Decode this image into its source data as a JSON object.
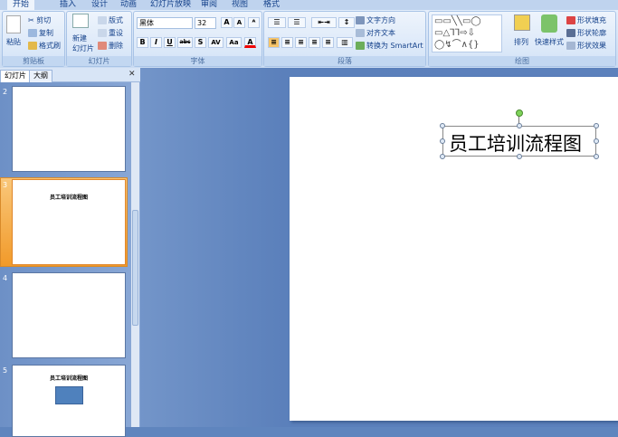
{
  "ribbon": {
    "tabs": [
      "开始",
      "插入",
      "设计",
      "动画",
      "幻灯片放映",
      "审阅",
      "视图",
      "格式"
    ],
    "clipboard": {
      "paste": "粘贴",
      "cut": "剪切",
      "copy": "复制",
      "format_painter": "格式刷",
      "label": "剪贴板"
    },
    "slides": {
      "new_slide": "新建",
      "new_slide2": "幻灯片",
      "layout": "版式",
      "reset": "重设",
      "delete": "删除",
      "label": "幻灯片"
    },
    "font": {
      "font_name": "黑体",
      "font_size": "32",
      "bold": "B",
      "italic": "I",
      "underline": "U",
      "strike": "abc",
      "shadow": "S",
      "spacing": "AV",
      "case": "Aa",
      "color": "A",
      "grow": "A",
      "shrink": "A",
      "label": "字体"
    },
    "paragraph": {
      "text_direction": "文字方向",
      "align_text": "对齐文本",
      "smartart": "转换为 SmartArt",
      "label": "段落"
    },
    "drawing": {
      "arrange": "排列",
      "quick_styles": "快速样式",
      "fill": "形状填充",
      "outline": "形状轮廓",
      "effects": "形状效果",
      "label": "绘图"
    }
  },
  "panel": {
    "tab_slides": "幻灯片",
    "tab_outline": "大纲",
    "close": "✕",
    "thumbs": [
      {
        "num": "2",
        "title": ""
      },
      {
        "num": "3",
        "title": "员工培训流程图"
      },
      {
        "num": "4",
        "title": ""
      },
      {
        "num": "5",
        "title": "员工培训流程图"
      }
    ]
  },
  "slide": {
    "title": "员工培训流程图"
  }
}
